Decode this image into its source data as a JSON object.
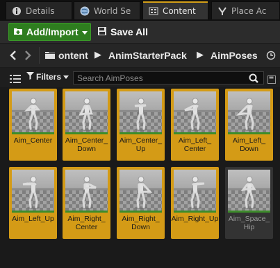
{
  "tabs": [
    {
      "label": "Details",
      "icon": "info-icon"
    },
    {
      "label": "World Se",
      "icon": "globe-icon"
    },
    {
      "label": "Content",
      "icon": "content-browser-icon",
      "active": true
    },
    {
      "label": "Place Ac",
      "icon": "place-actors-icon"
    }
  ],
  "toolbar": {
    "add_import_label": "Add/Import",
    "save_all_label": "Save All"
  },
  "breadcrumb": {
    "items": [
      "ontent",
      "AnimStarterPack",
      "AimPoses"
    ]
  },
  "filters": {
    "label": "Filters",
    "search_placeholder": "Search AimPoses"
  },
  "assets": [
    {
      "label": "Aim_Center",
      "selected": true
    },
    {
      "label": "Aim_Center_ Down",
      "selected": true
    },
    {
      "label": "Aim_Center_ Up",
      "selected": true
    },
    {
      "label": "Aim_Left_ Center",
      "selected": true
    },
    {
      "label": "Aim_Left_ Down",
      "selected": true
    },
    {
      "label": "Aim_Left_Up",
      "selected": true
    },
    {
      "label": "Aim_Right_ Center",
      "selected": true
    },
    {
      "label": "Aim_Right_ Down",
      "selected": true
    },
    {
      "label": "Aim_Right_Up",
      "selected": true
    },
    {
      "label": "Aim_Space_ Hip",
      "selected": false
    }
  ],
  "colors": {
    "selection": "#d49b16",
    "add_button": "#2e7d1f",
    "active_tab_accent": "#d5a017"
  }
}
